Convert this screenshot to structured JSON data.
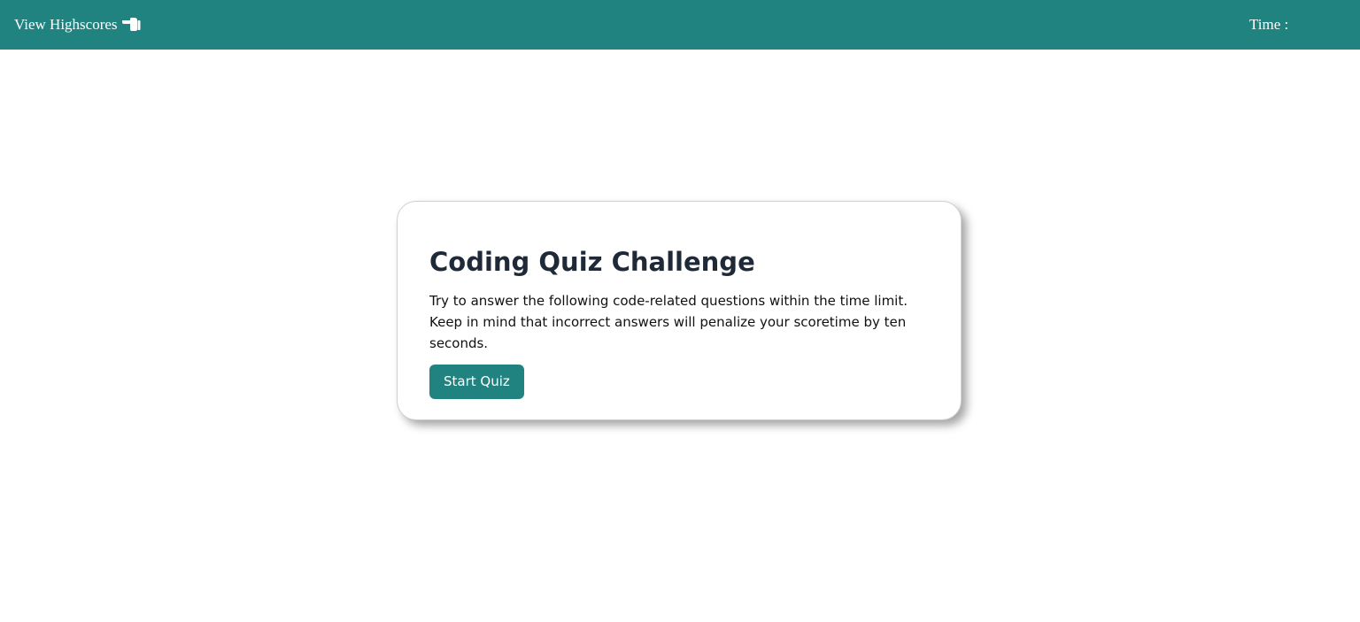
{
  "header": {
    "highscores_label": "View Highscores",
    "highscores_icon": "pointing-hand-icon",
    "timer_label": "Time :"
  },
  "intro": {
    "title": "Coding Quiz Challenge",
    "line1": "Try to answer the following code-related questions within the time limit.",
    "line2": "Keep in mind that incorrect answers will penalize your scoretime by ten seconds.",
    "start_label": "Start Quiz"
  },
  "colors": {
    "accent": "#218380",
    "title": "#1f2937",
    "background": "#ffffff"
  }
}
